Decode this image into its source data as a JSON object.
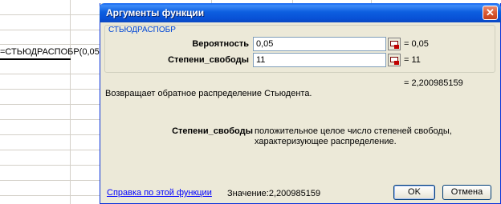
{
  "spreadsheet": {
    "cell_formula": "=СТЬЮДРАСПОБР(0,05"
  },
  "dialog": {
    "title": "Аргументы функции",
    "close_glyph": "✕",
    "function_name": "СТЬЮДРАСПОБР",
    "args": [
      {
        "label": "Вероятность",
        "value": "0,05",
        "result": "= 0,05"
      },
      {
        "label": "Степени_свободы",
        "value": "11",
        "result": "= 11"
      }
    ],
    "total_result": "= 2,200985159",
    "description": "Возвращает обратное распределение Стьюдента.",
    "help_arg_name": "Степени_свободы",
    "help_arg_text": "положительное целое число степеней свободы, характеризующее распределение.",
    "help_link": "Справка по этой функции",
    "value_text": "Значение:2,200985159",
    "ok_label": "OK",
    "cancel_label": "Отмена"
  }
}
